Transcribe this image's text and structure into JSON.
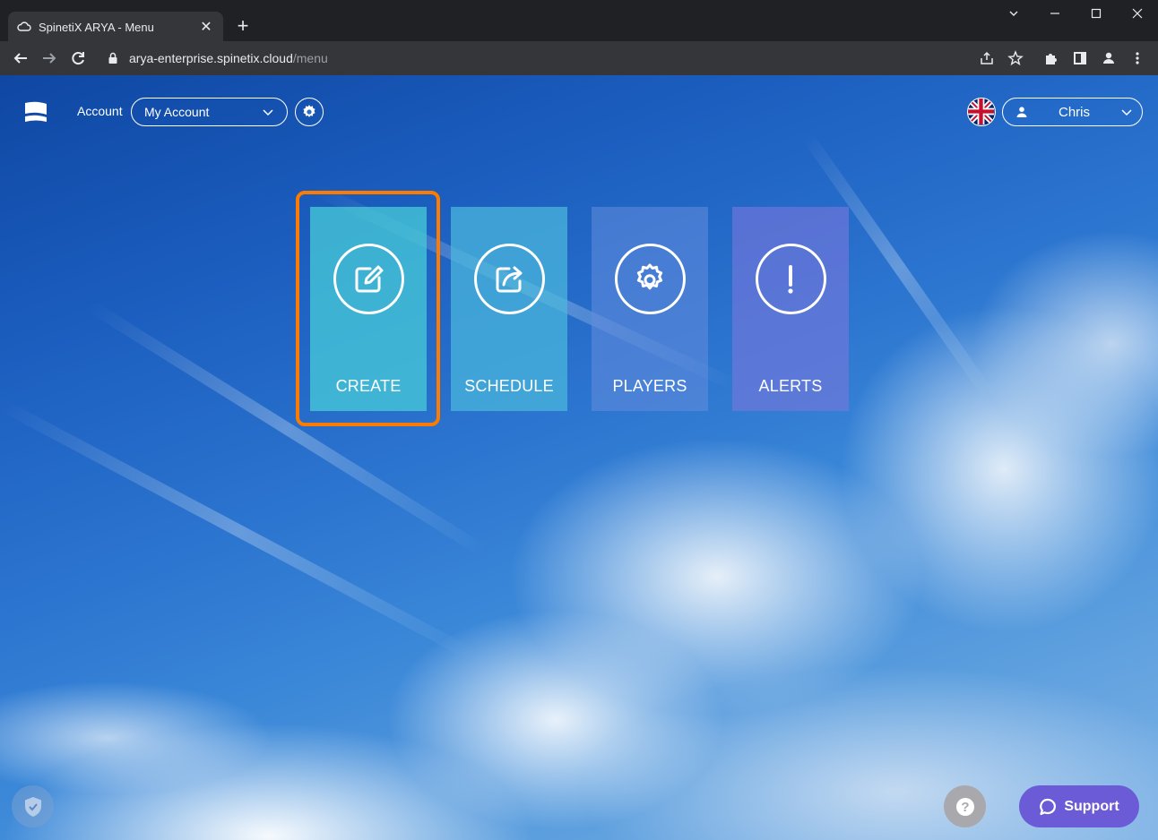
{
  "browser": {
    "tab_title": "SpinetiX ARYA - Menu",
    "new_tab_label": "+",
    "url_host": "arya-enterprise.spinetix.cloud",
    "url_path": "/menu"
  },
  "header": {
    "account_label": "Account",
    "account_selected": "My Account",
    "user_name": "Chris",
    "language_icon": "uk-flag-icon"
  },
  "menu": {
    "tiles": [
      {
        "label": "CREATE",
        "icon": "edit-icon"
      },
      {
        "label": "SCHEDULE",
        "icon": "share-icon"
      },
      {
        "label": "PLAYERS",
        "icon": "gear-icon"
      },
      {
        "label": "ALERTS",
        "icon": "exclamation-icon"
      }
    ],
    "highlight_color": "#ff7b00"
  },
  "footer": {
    "help_label": "?",
    "support_label": "Support",
    "support_color": "#6b5bd6"
  }
}
